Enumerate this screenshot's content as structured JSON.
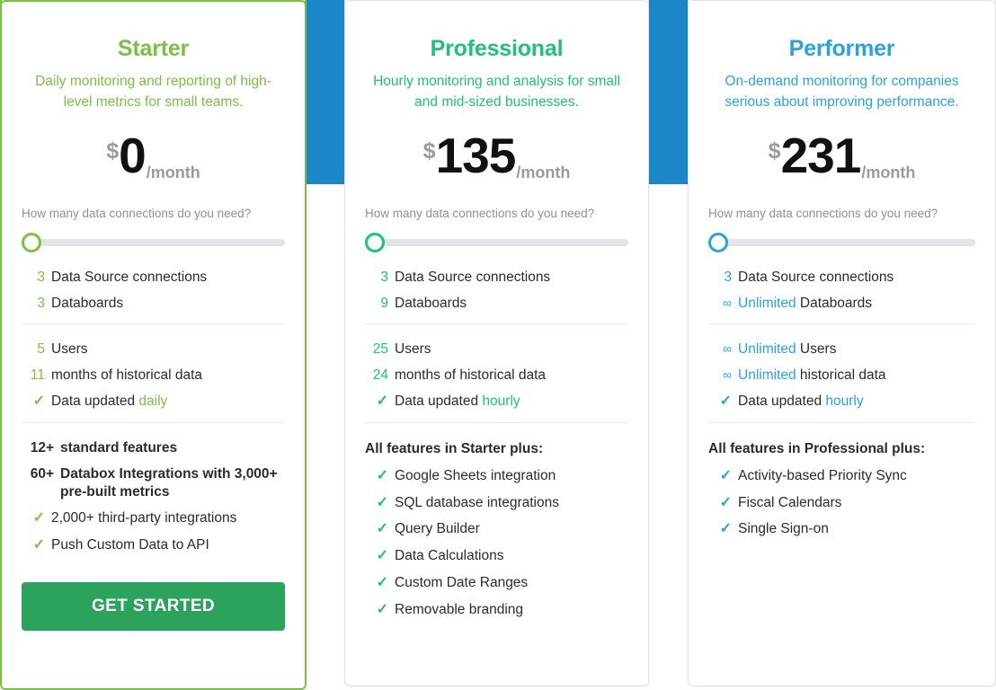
{
  "theme": {
    "banner_bg": "#1b87c9",
    "starter_accent": "#7ac143",
    "professional_accent": "#1ec27a",
    "performer_accent": "#29a3e0",
    "cta_bg": "#2ba35c",
    "price_color": "#111111",
    "muted": "#9b9b9b"
  },
  "slider_question": "How many data connections do you need?",
  "icons": {
    "check": "✓",
    "infinity": "∞",
    "slider_knob": "slider-knob-icon"
  },
  "plans": [
    {
      "id": "starter",
      "title": "Starter",
      "description": "Daily monitoring and reporting of high-level metrics for small teams.",
      "currency": "$",
      "amount": "0",
      "period": "/month",
      "accent": "#7ac143",
      "slider_question": "How many data connections do you need?",
      "slider_value": 0,
      "group_a": [
        {
          "num": "3",
          "text": "Data Source connections",
          "highlight": ""
        },
        {
          "num": "3",
          "text": "Databoards",
          "highlight": ""
        }
      ],
      "group_b": [
        {
          "num": "5",
          "text": "Users",
          "highlight": ""
        },
        {
          "num": "11",
          "text": "months of historical data",
          "highlight": ""
        },
        {
          "check": true,
          "text": "Data updated ",
          "highlight": "daily"
        }
      ],
      "features_heading": "",
      "numbered_features": [
        {
          "num": "12+",
          "text": "standard features"
        },
        {
          "num": "60+",
          "text": "Databox Integrations with 3,000+ pre-built metrics"
        }
      ],
      "checked_features": [
        "2,000+ third-party integrations",
        "Push Custom Data to API"
      ],
      "cta_label": "GET STARTED",
      "has_cta": true
    },
    {
      "id": "professional",
      "title": "Professional",
      "description": "Hourly monitoring and analysis for small and mid-sized businesses.",
      "currency": "$",
      "amount": "135",
      "period": "/month",
      "accent": "#1ec27a",
      "slider_question": "How many data connections do you need?",
      "slider_value": 0,
      "group_a": [
        {
          "num": "3",
          "text": "Data Source connections",
          "highlight": ""
        },
        {
          "num": "9",
          "text": "Databoards",
          "highlight": ""
        }
      ],
      "group_b": [
        {
          "num": "25",
          "text": "Users",
          "highlight": ""
        },
        {
          "num": "24",
          "text": "months of historical data",
          "highlight": ""
        },
        {
          "check": true,
          "text": "Data updated ",
          "highlight": "hourly"
        }
      ],
      "features_heading": "All features in Starter plus:",
      "numbered_features": [],
      "checked_features": [
        "Google Sheets integration",
        "SQL database integrations",
        "Query Builder",
        "Data Calculations",
        "Custom Date Ranges",
        "Removable branding"
      ],
      "cta_label": "",
      "has_cta": false
    },
    {
      "id": "performer",
      "title": "Performer",
      "description": "On-demand monitoring for companies serious about improving performance.",
      "currency": "$",
      "amount": "231",
      "period": "/month",
      "accent": "#29a3e0",
      "slider_question": "How many data connections do you need?",
      "slider_value": 0,
      "group_a": [
        {
          "num": "3",
          "text": "Data Source connections",
          "highlight": ""
        },
        {
          "num": "∞",
          "text": "Databoards",
          "highlight": "Unlimited ",
          "infinity": true
        }
      ],
      "group_b": [
        {
          "num": "∞",
          "text": "Users",
          "highlight": "Unlimited ",
          "infinity": true
        },
        {
          "num": "∞",
          "text": "historical data",
          "highlight": "Unlimited ",
          "infinity": true
        },
        {
          "check": true,
          "text": "Data updated ",
          "highlight": "hourly"
        }
      ],
      "features_heading": "All features in Professional plus:",
      "numbered_features": [],
      "checked_features": [
        "Activity-based Priority Sync",
        "Fiscal Calendars",
        "Single Sign-on"
      ],
      "cta_label": "",
      "has_cta": false
    }
  ]
}
